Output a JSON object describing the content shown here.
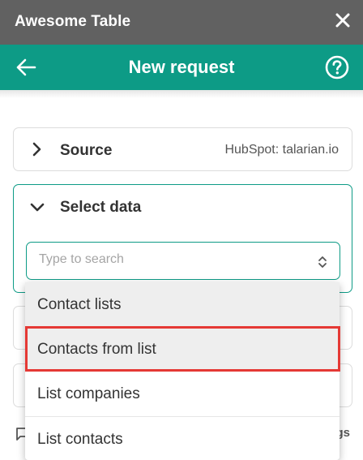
{
  "window": {
    "title": "Awesome Table",
    "close_icon": "close-icon"
  },
  "header": {
    "title": "New request",
    "back_icon": "arrow-left-icon",
    "help_icon": "help-circle-icon",
    "color": "#0d9b86"
  },
  "source": {
    "label": "Source",
    "value": "HubSpot: talarian.io"
  },
  "select_data": {
    "label": "Select data",
    "search_placeholder": "Type to search",
    "search_value": ""
  },
  "dropdown": {
    "items": [
      {
        "label": "Contact lists"
      },
      {
        "label": "Contacts from list"
      },
      {
        "label": "List companies"
      },
      {
        "label": "List contacts"
      }
    ],
    "highlight_color": "#e53935"
  },
  "footer": {
    "partial_text": "gs"
  }
}
